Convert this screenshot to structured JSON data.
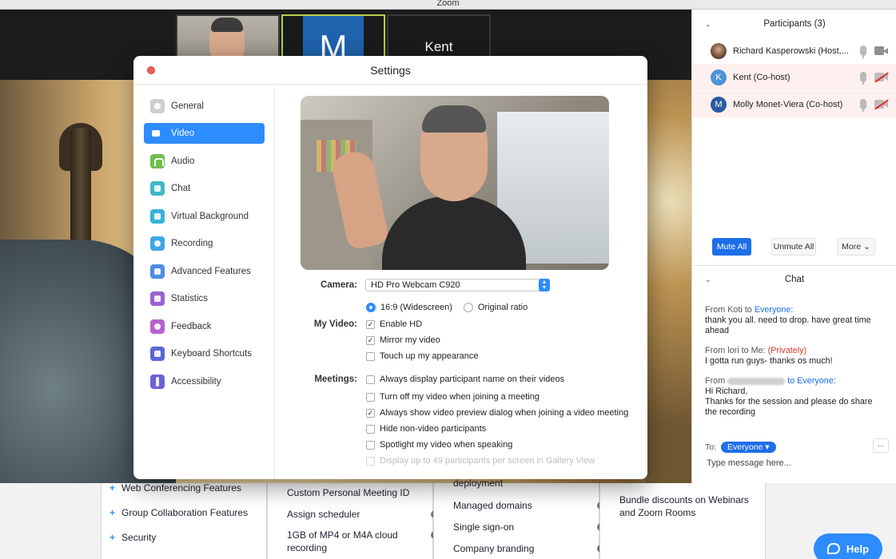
{
  "window": {
    "title": "Zoom"
  },
  "thumbnails": [
    {
      "kind": "video",
      "name": ""
    },
    {
      "kind": "initial",
      "initial": "M"
    },
    {
      "kind": "name",
      "name": "Kent"
    }
  ],
  "settings": {
    "title": "Settings",
    "nav": [
      {
        "label": "General",
        "icon": "gear-icon"
      },
      {
        "label": "Video",
        "icon": "video-camera-icon",
        "active": true
      },
      {
        "label": "Audio",
        "icon": "headphones-icon"
      },
      {
        "label": "Chat",
        "icon": "chat-bubble-icon"
      },
      {
        "label": "Virtual Background",
        "icon": "person-image-icon"
      },
      {
        "label": "Recording",
        "icon": "record-icon"
      },
      {
        "label": "Advanced Features",
        "icon": "sparkle-icon"
      },
      {
        "label": "Statistics",
        "icon": "bar-chart-icon"
      },
      {
        "label": "Feedback",
        "icon": "smiley-icon"
      },
      {
        "label": "Keyboard Shortcuts",
        "icon": "keyboard-icon"
      },
      {
        "label": "Accessibility",
        "icon": "accessibility-icon"
      }
    ],
    "video": {
      "camera_label": "Camera:",
      "camera_value": "HD Pro Webcam C920",
      "my_video_label": "My Video:",
      "ratio_options": [
        {
          "label": "16:9 (Widescreen)",
          "selected": true
        },
        {
          "label": "Original ratio",
          "selected": false
        }
      ],
      "my_video_options": [
        {
          "label": "Enable HD",
          "checked": true
        },
        {
          "label": "Mirror my video",
          "checked": true
        },
        {
          "label": "Touch up my appearance",
          "checked": false
        }
      ],
      "meetings_label": "Meetings:",
      "meetings_options": [
        {
          "label": "Always display participant name on their videos",
          "checked": false
        },
        {
          "label": "Turn off my video when joining a meeting",
          "checked": false
        },
        {
          "label": "Always show video preview dialog when joining a video meeting",
          "checked": true
        },
        {
          "label": "Hide non-video participants",
          "checked": false
        },
        {
          "label": "Spotlight my video when speaking",
          "checked": false
        },
        {
          "label": "Display up to 49 participants per screen in Gallery View",
          "checked": false,
          "disabled": true
        }
      ]
    }
  },
  "participants": {
    "title": "Participants (3)",
    "list": [
      {
        "name": "Richard Kasperowski (Host,...",
        "avatar": "",
        "muted": true,
        "video_off": false
      },
      {
        "name": "Kent (Co-host)",
        "avatar": "K",
        "muted": true,
        "video_off": true
      },
      {
        "name": "Molly Monet-Viera (Co-host)",
        "avatar": "M",
        "muted": true,
        "video_off": true
      }
    ],
    "mute_all": "Mute All",
    "unmute_all": "Unmute All",
    "more": "More"
  },
  "chat": {
    "title": "Chat",
    "messages": [
      {
        "from": "From Koti to ",
        "to": "Everyone:",
        "private": "",
        "text": "thank you all. need to drop. have great time ahead"
      },
      {
        "from": "From lori to Me: ",
        "to": "",
        "private": "(Privately)",
        "text": "I gotta run guys- thanks os much!"
      },
      {
        "from": "From",
        "to": "to Everyone:",
        "private": "",
        "text": "Hi Richard,\nThanks for the session and please do share the recording"
      }
    ],
    "to_label": "To:",
    "to_value": "Everyone",
    "input_placeholder": "Type message here...",
    "more_label": "..."
  },
  "website": {
    "col1": [
      "Web Conferencing Features",
      "Group Collaboration Features",
      "Security"
    ],
    "col2": [
      "Custom Personal Meeting ID",
      "Assign scheduler",
      "1GB of MP4 or M4A cloud",
      "recording"
    ],
    "col3": [
      "deployment",
      "Managed domains",
      "Single sign-on",
      "Company branding"
    ],
    "col4": [
      "Bundle discounts on Webinars",
      "and Zoom Rooms"
    ],
    "help": "Help"
  }
}
